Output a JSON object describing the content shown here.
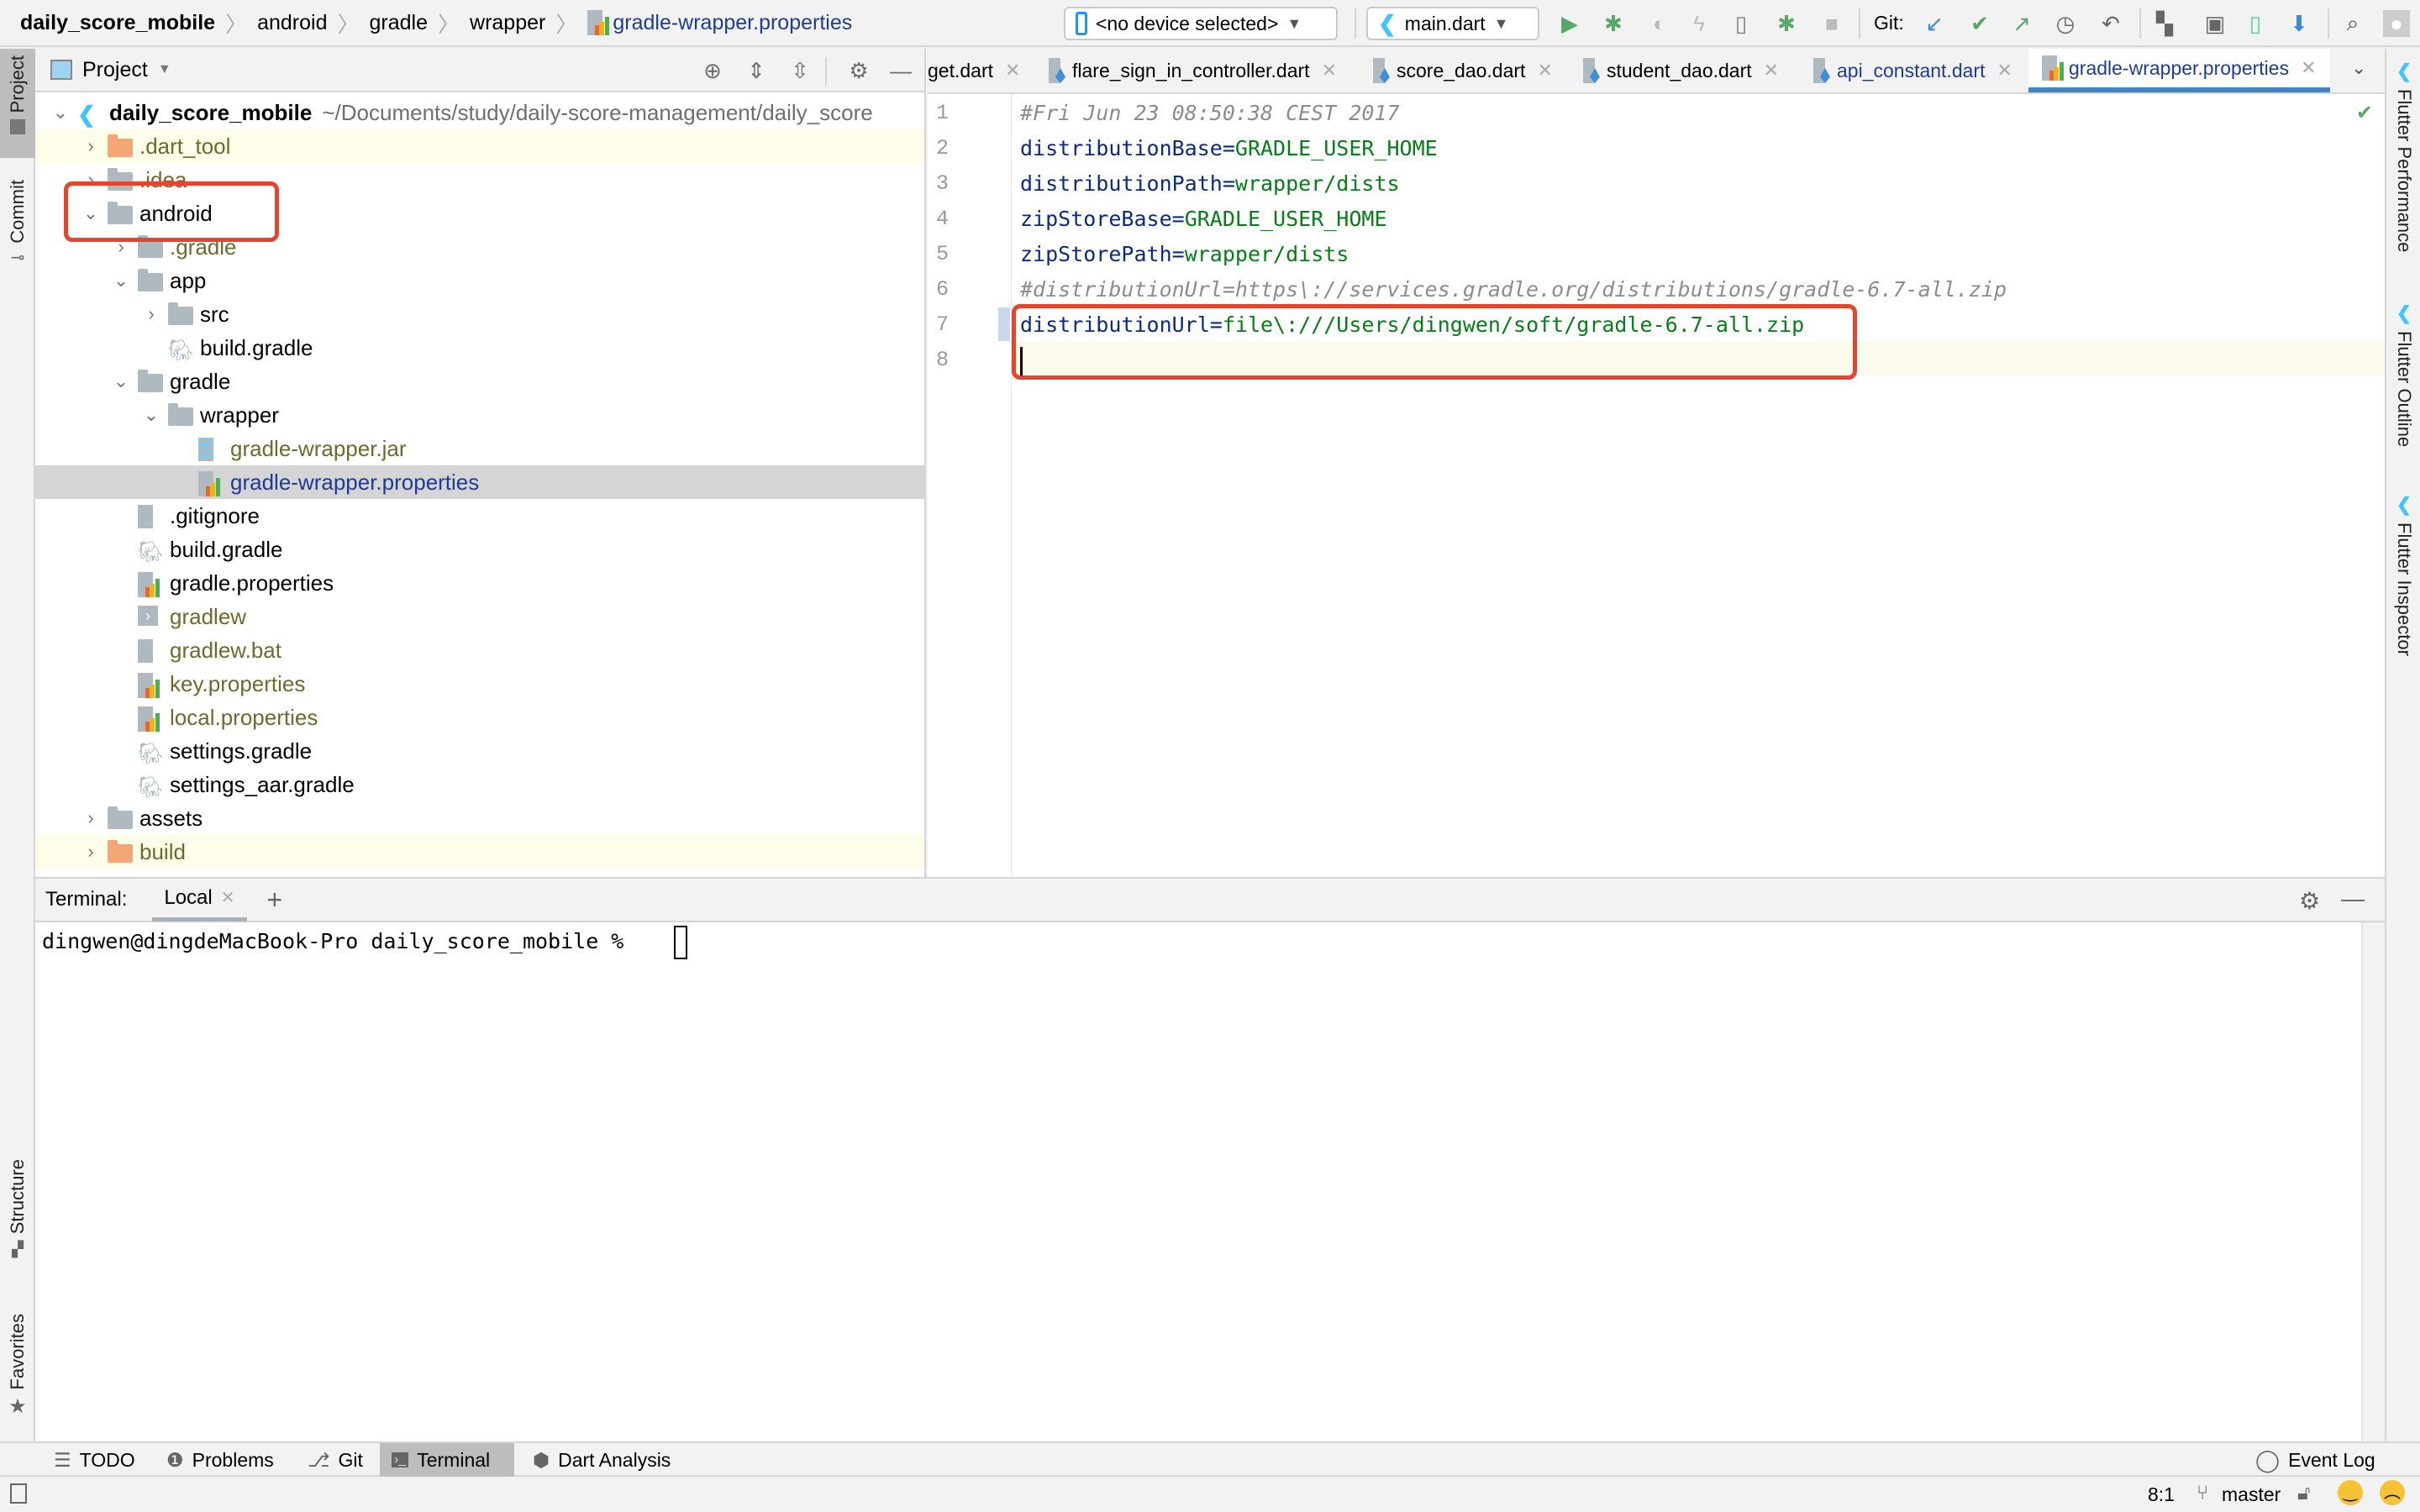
{
  "breadcrumb": [
    "daily_score_mobile",
    "android",
    "gradle",
    "wrapper",
    "gradle-wrapper.properties"
  ],
  "toolbar": {
    "device_selector": "<no device selected>",
    "run_config": "main.dart",
    "git_label": "Git:",
    "icons": [
      "run-icon",
      "debug-icon",
      "attach-icon",
      "hot-reload-icon",
      "device-manager-icon",
      "debug-attach-icon",
      "stop-icon",
      "git-update-icon",
      "git-commit-icon",
      "git-push-icon",
      "git-history-icon",
      "git-rollback-icon",
      "project-structure-icon",
      "sdk-manager-icon",
      "avd-manager-icon",
      "flutter-icon",
      "search-icon"
    ]
  },
  "left_stripe": {
    "tabs": [
      "Project",
      "Commit",
      "Structure",
      "Favorites"
    ]
  },
  "right_stripe": {
    "tabs": [
      "Flutter Performance",
      "Flutter Outline",
      "Flutter Inspector"
    ]
  },
  "project_panel": {
    "title": "Project",
    "tree": [
      {
        "label": "daily_score_mobile",
        "suffix": "~/Documents/study/daily-score-management/daily_score",
        "depth": 0,
        "arrow": "down",
        "icon": "flutter-module-icon",
        "style": "bold"
      },
      {
        "label": ".dart_tool",
        "depth": 1,
        "arrow": "right",
        "icon": "folder-excluded-icon",
        "style": "olive",
        "highlight": true
      },
      {
        "label": ".idea",
        "depth": 1,
        "arrow": "right",
        "icon": "folder-idea-icon",
        "style": "olive"
      },
      {
        "label": "android",
        "depth": 1,
        "arrow": "down",
        "icon": "folder-module-icon",
        "style": "normal"
      },
      {
        "label": ".gradle",
        "depth": 2,
        "arrow": "right",
        "icon": "folder-icon",
        "style": "olive"
      },
      {
        "label": "app",
        "depth": 2,
        "arrow": "down",
        "icon": "folder-icon",
        "style": "normal"
      },
      {
        "label": "src",
        "depth": 3,
        "arrow": "right",
        "icon": "folder-icon",
        "style": "normal"
      },
      {
        "label": "build.gradle",
        "depth": 3,
        "arrow": "",
        "icon": "gradle-icon",
        "style": "normal"
      },
      {
        "label": "gradle",
        "depth": 2,
        "arrow": "down",
        "icon": "folder-icon",
        "style": "normal"
      },
      {
        "label": "wrapper",
        "depth": 3,
        "arrow": "down",
        "icon": "folder-icon",
        "style": "normal"
      },
      {
        "label": "gradle-wrapper.jar",
        "depth": 4,
        "arrow": "",
        "icon": "jar-icon",
        "style": "olive"
      },
      {
        "label": "gradle-wrapper.properties",
        "depth": 4,
        "arrow": "",
        "icon": "properties-icon",
        "style": "blue",
        "selected": true
      },
      {
        "label": ".gitignore",
        "depth": 2,
        "arrow": "",
        "icon": "gitignore-icon",
        "style": "normal"
      },
      {
        "label": "build.gradle",
        "depth": 2,
        "arrow": "",
        "icon": "gradle-icon",
        "style": "normal"
      },
      {
        "label": "gradle.properties",
        "depth": 2,
        "arrow": "",
        "icon": "properties-icon",
        "style": "normal"
      },
      {
        "label": "gradlew",
        "depth": 2,
        "arrow": "",
        "icon": "shell-script-icon",
        "style": "olive"
      },
      {
        "label": "gradlew.bat",
        "depth": 2,
        "arrow": "",
        "icon": "text-file-icon",
        "style": "olive"
      },
      {
        "label": "key.properties",
        "depth": 2,
        "arrow": "",
        "icon": "properties-icon",
        "style": "olive"
      },
      {
        "label": "local.properties",
        "depth": 2,
        "arrow": "",
        "icon": "properties-icon",
        "style": "olive"
      },
      {
        "label": "settings.gradle",
        "depth": 2,
        "arrow": "",
        "icon": "gradle-icon",
        "style": "normal"
      },
      {
        "label": "settings_aar.gradle",
        "depth": 2,
        "arrow": "",
        "icon": "gradle-icon",
        "style": "normal"
      },
      {
        "label": "assets",
        "depth": 1,
        "arrow": "right",
        "icon": "folder-icon",
        "style": "normal"
      },
      {
        "label": "build",
        "depth": 1,
        "arrow": "right",
        "icon": "folder-excluded-icon",
        "style": "olive",
        "highlight": true
      }
    ]
  },
  "editor": {
    "tabs": [
      {
        "label": "get.dart",
        "active": false
      },
      {
        "label": "flare_sign_in_controller.dart",
        "active": false
      },
      {
        "label": "score_dao.dart",
        "active": false
      },
      {
        "label": "student_dao.dart",
        "active": false
      },
      {
        "label": "api_constant.dart",
        "active": false,
        "modified": true
      },
      {
        "label": "gradle-wrapper.properties",
        "active": true
      }
    ],
    "lines": [
      {
        "n": "1",
        "comment": "#Fri Jun 23 08:50:38 CEST 2017"
      },
      {
        "n": "2",
        "key": "distributionBase",
        "value": "GRADLE_USER_HOME"
      },
      {
        "n": "3",
        "key": "distributionPath",
        "value": "wrapper/dists"
      },
      {
        "n": "4",
        "key": "zipStoreBase",
        "value": "GRADLE_USER_HOME"
      },
      {
        "n": "5",
        "key": "zipStorePath",
        "value": "wrapper/dists"
      },
      {
        "n": "6",
        "comment": "#distributionUrl=https\\://services.gradle.org/distributions/gradle-6.7-all.zip"
      },
      {
        "n": "7",
        "key": "distributionUrl",
        "value": "file\\:///Users/dingwen/soft/gradle-6.7-all.zip"
      },
      {
        "n": "8",
        "key": "",
        "value": ""
      }
    ],
    "eq": "="
  },
  "terminal": {
    "label": "Terminal:",
    "tab": "Local",
    "prompt": "dingwen@dingdeMacBook-Pro daily_score_mobile % "
  },
  "tool_windows": [
    {
      "label": "TODO",
      "icon": "todo-icon"
    },
    {
      "label": "Problems",
      "icon": "problems-icon"
    },
    {
      "label": "Git",
      "icon": "git-icon"
    },
    {
      "label": "Terminal",
      "icon": "terminal-icon",
      "active": true
    },
    {
      "label": "Dart Analysis",
      "icon": "dart-analysis-icon"
    }
  ],
  "event_log": "Event Log",
  "status": {
    "position": "8:1",
    "branch": "master"
  }
}
